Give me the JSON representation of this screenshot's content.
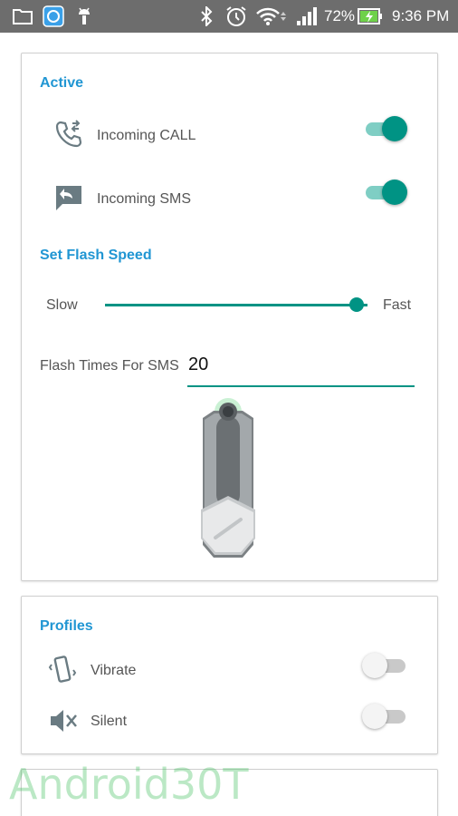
{
  "status_bar": {
    "battery": "72%",
    "time": "9:36 PM",
    "icons": [
      "folder-icon",
      "app-icon",
      "android-icon",
      "bluetooth-icon",
      "alarm-icon",
      "wifi-icon",
      "signal-icon",
      "battery-charging-icon"
    ]
  },
  "active": {
    "title": "Active",
    "call_label": "Incoming CALL",
    "call_enabled": true,
    "sms_label": "Incoming SMS",
    "sms_enabled": true
  },
  "flash_speed": {
    "title": "Set Flash Speed",
    "slow_label": "Slow",
    "fast_label": "Fast",
    "value": 0.96
  },
  "flash_times": {
    "label": "Flash Times For SMS",
    "value": "20"
  },
  "profiles": {
    "title": "Profiles",
    "vibrate_label": "Vibrate",
    "vibrate_enabled": false,
    "silent_label": "Silent",
    "silent_enabled": false
  },
  "watermark": "Android30T",
  "colors": {
    "accent": "#009384",
    "title_blue": "#2196d3",
    "status_bar": "#6d6d6d"
  }
}
